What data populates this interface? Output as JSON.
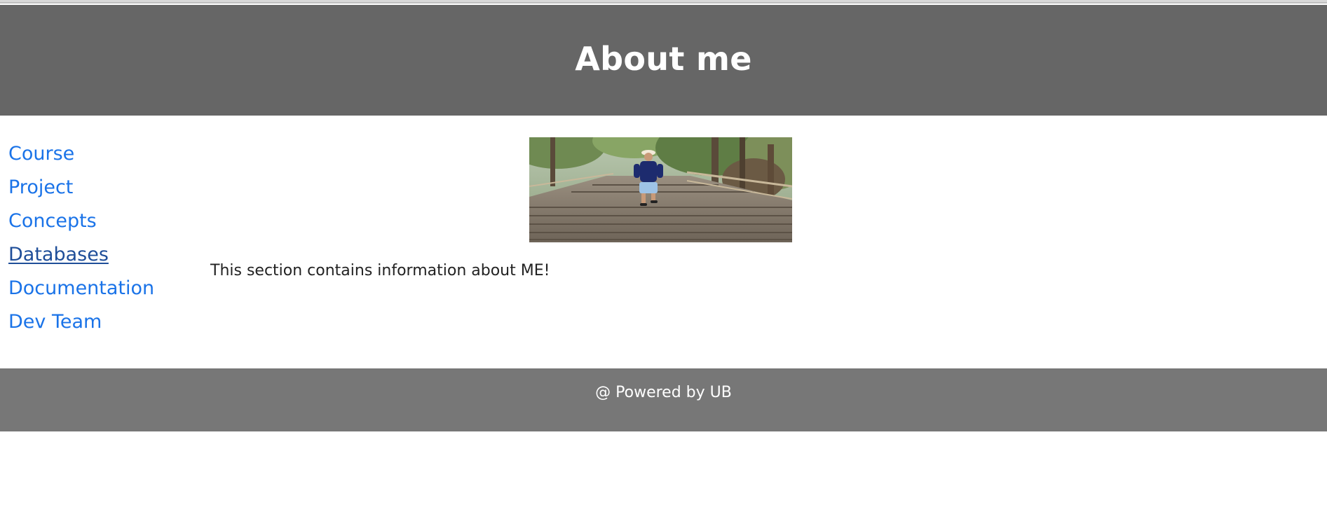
{
  "header": {
    "title": "About me"
  },
  "nav": {
    "items": [
      {
        "label": "Course"
      },
      {
        "label": "Project"
      },
      {
        "label": "Concepts"
      },
      {
        "label": "Databases"
      },
      {
        "label": "Documentation"
      },
      {
        "label": "Dev Team"
      }
    ],
    "active_index": 3
  },
  "main": {
    "intro_text": "This section contains information about ME!"
  },
  "footer": {
    "text": "@ Powered by UB"
  },
  "colors": {
    "header_bg": "#666666",
    "footer_bg": "#777777",
    "link": "#1a73e8",
    "link_active": "#1f4e99"
  }
}
